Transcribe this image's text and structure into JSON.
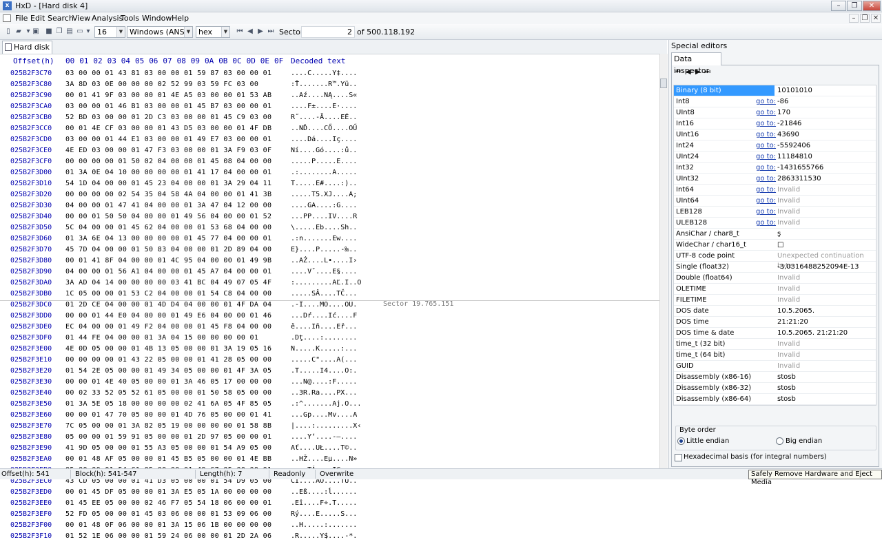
{
  "window": {
    "title": "HxD - [Hard disk 4]",
    "app_icon": "hxd-app-icon"
  },
  "menu": [
    "File",
    "Edit",
    "Search",
    "View",
    "Analysis",
    "Tools",
    "Window",
    "Help"
  ],
  "toolbar": {
    "bytes_per_row": "16",
    "charset": "Windows (ANSI)",
    "offset_base": "hex",
    "sector_label": "Sector",
    "sector_value": "2",
    "sector_total": "of 500.118.192"
  },
  "tab": {
    "label": "Hard disk 4"
  },
  "hex": {
    "offset_header": "Offset(h)",
    "col_headers": [
      "00",
      "01",
      "02",
      "03",
      "04",
      "05",
      "06",
      "07",
      "08",
      "09",
      "0A",
      "0B",
      "0C",
      "0D",
      "0E",
      "0F"
    ],
    "decoded_header": "Decoded text",
    "sector_marker": "Sector 19.765.151",
    "rows": [
      {
        "o": "025B2F3C70",
        "b": "03 00 00 01 43 81 03 00 00 01 59 87 03 00 00 01",
        "t": "....C.....Y‡...."
      },
      {
        "o": "025B2F3C80",
        "b": "3A 8D 03 0E 00 00 00 02 52 99 03 59 FC 03 00",
        "t": ":Ť.......R™.Yü.."
      },
      {
        "o": "025B2F3C90",
        "b": "00 01 41 9F 03 00 00 01 4E A5 03 00 00 01 53 AB",
        "t": "..Aź....NĄ....S«"
      },
      {
        "o": "025B2F3CA0",
        "b": "03 00 00 01 46 B1 03 00 00 01 45 B7 03 00 00 01",
        "t": "....F±....E·...."
      },
      {
        "o": "025B2F3CB0",
        "b": "52 BD 03 00 00 01 2D C3 03 00 00 01 45 C9 03 00",
        "t": "R˝....-Ă....EÉ.."
      },
      {
        "o": "025B2F3CC0",
        "b": "00 01 4E CF 03 00 00 01 43 D5 03 00 00 01 4F DB",
        "t": "..NĎ....CŐ....OŰ"
      },
      {
        "o": "025B2F3CD0",
        "b": "03 00 00 01 44 E1 03 00 00 01 49 E7 03 00 00 01",
        "t": "....Dá....Iç...."
      },
      {
        "o": "025B2F3CE0",
        "b": "4E ED 03 00 00 01 47 F3 03 00 00 01 3A F9 03 0F",
        "t": "Ní....Gó....:ů.."
      },
      {
        "o": "025B2F3CF0",
        "b": "00 00 00 00 01 50 02 04 00 00 01 45 08 04 00 00",
        "t": ".....P.....E...."
      },
      {
        "o": "025B2F3D00",
        "b": "01 3A 0E 04 10 00 00 00 00 01 41 17 04 00 00 01",
        "t": ".:........A....."
      },
      {
        "o": "025B2F3D10",
        "b": "54 1D 04 00 00 01 45 23 04 00 00 01 3A 29 04 11",
        "t": "T.....E#....:).."
      },
      {
        "o": "025B2F3D20",
        "b": "00 00 00 00 02 54 35 04 58 4A 04 00 00 01 41 3B",
        "t": ".....T5.XJ....A;"
      },
      {
        "o": "025B2F3D30",
        "b": "04 00 00 01 47 41 04 00 00 01 3A 47 04 12 00 00",
        "t": "....GA....:G...."
      },
      {
        "o": "025B2F3D40",
        "b": "00 00 01 50 50 04 00 00 01 49 56 04 00 00 01 52",
        "t": "...PP....IV....R"
      },
      {
        "o": "025B2F3D50",
        "b": "5C 04 00 00 01 45 62 04 00 00 01 53 68 04 00 00",
        "t": "\\.....Eb....Sh.."
      },
      {
        "o": "025B2F3D60",
        "b": "01 3A 6E 04 13 00 00 00 00 01 45 77 04 00 00 01",
        "t": ".:n.......Ew...."
      },
      {
        "o": "025B2F3D70",
        "b": "45 7D 04 00 00 01 50 83 04 00 00 01 2D 89 04 00",
        "t": "E}....P.....-‰.."
      },
      {
        "o": "025B2F3D80",
        "b": "00 01 41 8F 04 00 00 01 4C 95 04 00 00 01 49 9B",
        "t": "..AŹ....L•....I›"
      },
      {
        "o": "025B2F3D90",
        "b": "04 00 00 01 56 A1 04 00 00 01 45 A7 04 00 00 01",
        "t": "....Vˇ....E§...."
      },
      {
        "o": "025B2F3DA0",
        "b": "3A AD 04 14 00 00 00 00 03 41 BC 04 49 07 05 4F",
        "t": ":.........AĽ.I..O"
      },
      {
        "o": "025B2F3DB0",
        "b": "1C 05 00 00 01 53 C2 04 00 00 01 54 C8 04 00 00",
        "t": ".....SÂ....TČ..."
      },
      {
        "o": "025B2F3DC0",
        "b": "01 2D CE 04 00 00 01 4D D4 04 00 00 01 4F DA 04",
        "t": ".-Î....MÔ....OÚ."
      },
      {
        "o": "025B2F3DD0",
        "b": "00 00 01 44 E0 04 00 00 01 49 E6 04 00 00 01 46",
        "t": "...Dŕ....Ić....F"
      },
      {
        "o": "025B2F3DE0",
        "b": "EC 04 00 00 01 49 F2 04 00 00 01 45 F8 04 00 00",
        "t": "ě....Iň....Eř..."
      },
      {
        "o": "025B2F3DF0",
        "b": "01 44 FE 04 00 00 01 3A 04 15 00 00 00 00 01",
        "t": ".Dţ....:........"
      },
      {
        "o": "025B2F3E00",
        "b": "4E 0D 05 00 00 01 4B 13 05 00 00 01 3A 19 05 16",
        "t": "N.....K.....:..."
      },
      {
        "o": "025B2F3E10",
        "b": "00 00 00 00 01 43 22 05 00 00 01 41 28 05 00 00",
        "t": ".....C\"....A(..."
      },
      {
        "o": "025B2F3E20",
        "b": "01 54 2E 05 00 00 01 49 34 05 00 00 01 4F 3A 05",
        "t": ".T.....I4....O:."
      },
      {
        "o": "025B2F3E30",
        "b": "00 00 01 4E 40 05 00 00 01 3A 46 05 17 00 00 00",
        "t": "...N@....:F....."
      },
      {
        "o": "025B2F3E40",
        "b": "00 02 33 52 05 52 61 05 00 00 01 50 58 05 00 00",
        "t": "..3R.Ra....PX..."
      },
      {
        "o": "025B2F3E50",
        "b": "01 3A 5E 05 18 00 00 00 00 02 41 6A 05 4F 85 05",
        "t": ".:^.......Aj.O..."
      },
      {
        "o": "025B2F3E60",
        "b": "00 00 01 47 70 05 00 00 01 4D 76 05 00 00 01 41",
        "t": "...Gp....Mv....A"
      },
      {
        "o": "025B2F3E70",
        "b": "7C 05 00 00 01 3A 82 05 19 00 00 00 00 01 58 8B",
        "t": "|....:.........X‹"
      },
      {
        "o": "025B2F3E80",
        "b": "05 00 00 01 59 91 05 00 00 01 2D 97 05 00 00 01",
        "t": "....Y‘....-—...."
      },
      {
        "o": "025B2F3E90",
        "b": "41 9D 05 00 00 01 55 A3 05 00 00 01 54 A9 05 00",
        "t": "Ať....UŁ....T©.."
      },
      {
        "o": "025B2F3EA0",
        "b": "00 01 48 AF 05 00 00 01 45 B5 05 00 00 01 4E BB",
        "t": "..HŽ....Eµ....N»"
      },
      {
        "o": "025B2F3EB0",
        "b": "05 00 00 01 54 C1 05 00 00 01 49 C7 05 00 00 01",
        "t": "....TÁ....IÇ...."
      },
      {
        "o": "025B2F3EC0",
        "b": "43 CD 05 00 00 01 41 D3 05 00 00 01 54 D9 05 00",
        "t": "CÍ....AÓ....TŮ.."
      },
      {
        "o": "025B2F3ED0",
        "b": "00 01 45 DF 05 00 00 01 3A E5 05 1A 00 00 00 00",
        "t": "..Eß....:ĺ......"
      },
      {
        "o": "025B2F3EE0",
        "b": "01 45 EE 05 00 00 02 46 F7 05 54 18 06 00 00 01",
        "t": ".Eî....F÷.T....."
      },
      {
        "o": "025B2F3EF0",
        "b": "52 FD 05 00 00 01 45 03 06 00 00 01 53 09 06 00",
        "t": "Rý....E.....S..."
      },
      {
        "o": "025B2F3F00",
        "b": "00 01 48 0F 06 00 00 01 3A 15 06 1B 00 00 00 00",
        "t": "..H.....:......."
      },
      {
        "o": "025B2F3F10",
        "b": "01 52 1E 06 00 00 01 59 24 06 00 00 01 2D 2A 06",
        "t": ".R.....Y$....-*."
      }
    ]
  },
  "special_editors": {
    "title": "Special editors",
    "tab": "Data inspector",
    "goto": "go to:",
    "rows": [
      {
        "name": "Binary (8 bit)",
        "goto": false,
        "value": "10101010",
        "invalid": false,
        "selected": true
      },
      {
        "name": "Int8",
        "goto": true,
        "value": "-86",
        "invalid": false
      },
      {
        "name": "UInt8",
        "goto": true,
        "value": "170",
        "invalid": false
      },
      {
        "name": "Int16",
        "goto": true,
        "value": "-21846",
        "invalid": false
      },
      {
        "name": "UInt16",
        "goto": true,
        "value": "43690",
        "invalid": false
      },
      {
        "name": "Int24",
        "goto": true,
        "value": "-5592406",
        "invalid": false
      },
      {
        "name": "UInt24",
        "goto": true,
        "value": "11184810",
        "invalid": false
      },
      {
        "name": "Int32",
        "goto": true,
        "value": "-1431655766",
        "invalid": false
      },
      {
        "name": "UInt32",
        "goto": true,
        "value": "2863311530",
        "invalid": false
      },
      {
        "name": "Int64",
        "goto": true,
        "value": "Invalid",
        "invalid": true
      },
      {
        "name": "UInt64",
        "goto": true,
        "value": "Invalid",
        "invalid": true
      },
      {
        "name": "LEB128",
        "goto": true,
        "value": "Invalid",
        "invalid": true
      },
      {
        "name": "ULEB128",
        "goto": true,
        "value": "Invalid",
        "invalid": true
      },
      {
        "name": "AnsiChar / char8_t",
        "goto": false,
        "value": "ş",
        "invalid": false
      },
      {
        "name": "WideChar / char16_t",
        "goto": false,
        "value": "□",
        "invalid": false
      },
      {
        "name": "UTF-8 code point",
        "goto": false,
        "value": "Unexpected continuation byte",
        "invalid": true
      },
      {
        "name": "Single (float32)",
        "goto": false,
        "value": "-3,0316488252094E-13",
        "invalid": false
      },
      {
        "name": "Double (float64)",
        "goto": false,
        "value": "Invalid",
        "invalid": true
      },
      {
        "name": "OLETIME",
        "goto": false,
        "value": "Invalid",
        "invalid": true
      },
      {
        "name": "FILETIME",
        "goto": false,
        "value": "Invalid",
        "invalid": true
      },
      {
        "name": "DOS date",
        "goto": false,
        "value": "10.5.2065.",
        "invalid": false
      },
      {
        "name": "DOS time",
        "goto": false,
        "value": "21:21:20",
        "invalid": false
      },
      {
        "name": "DOS time & date",
        "goto": false,
        "value": "10.5.2065. 21:21:20",
        "invalid": false
      },
      {
        "name": "time_t (32 bit)",
        "goto": false,
        "value": "Invalid",
        "invalid": true
      },
      {
        "name": "time_t (64 bit)",
        "goto": false,
        "value": "Invalid",
        "invalid": true
      },
      {
        "name": "GUID",
        "goto": false,
        "value": "Invalid",
        "invalid": true
      },
      {
        "name": "Disassembly (x86-16)",
        "goto": false,
        "value": "stosb",
        "invalid": false
      },
      {
        "name": "Disassembly (x86-32)",
        "goto": false,
        "value": "stosb",
        "invalid": false
      },
      {
        "name": "Disassembly (x86-64)",
        "goto": false,
        "value": "stosb",
        "invalid": false
      }
    ],
    "byte_order": {
      "title": "Byte order",
      "little": "Little endian",
      "big": "Big endian",
      "selected": "little"
    },
    "hex_basis": "Hexadecimal basis (for integral numbers)"
  },
  "status": {
    "offset": "Offset(h): 541",
    "block": "Block(h): 541-547",
    "length": "Length(h): 7",
    "mode": "Readonly",
    "insert": "Overwrite",
    "tooltip": "Safely Remove Hardware and Eject Media"
  }
}
